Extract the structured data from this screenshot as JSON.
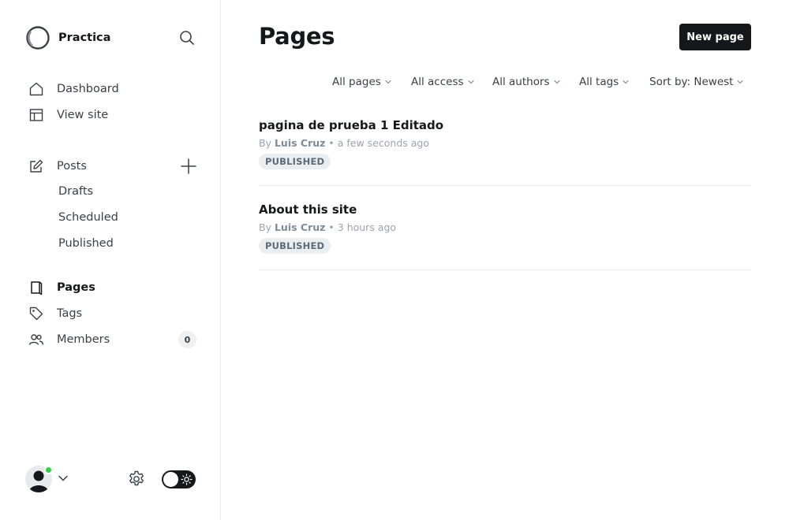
{
  "sidebar": {
    "brand_name": "Practica",
    "nav": {
      "dashboard": "Dashboard",
      "view_site": "View site",
      "posts": "Posts",
      "drafts": "Drafts",
      "scheduled": "Scheduled",
      "published": "Published",
      "pages": "Pages",
      "tags": "Tags",
      "members": "Members",
      "members_count": "0"
    }
  },
  "main": {
    "title": "Pages",
    "new_button": "New page",
    "filters": {
      "type": "All pages",
      "access": "All access",
      "authors": "All authors",
      "tags": "All tags",
      "sort": "Sort by: Newest"
    },
    "pages": [
      {
        "title": "pagina de prueba 1 Editado",
        "by": "By",
        "author": "Luis Cruz",
        "time": "a few seconds ago",
        "status": "PUBLISHED"
      },
      {
        "title": "About this site",
        "by": "By",
        "author": "Luis Cruz",
        "time": "3 hours ago",
        "status": "PUBLISHED"
      }
    ]
  },
  "colors": {
    "accent_dark": "#15171a",
    "online": "#30cf43",
    "muted": "#99a3ad"
  }
}
